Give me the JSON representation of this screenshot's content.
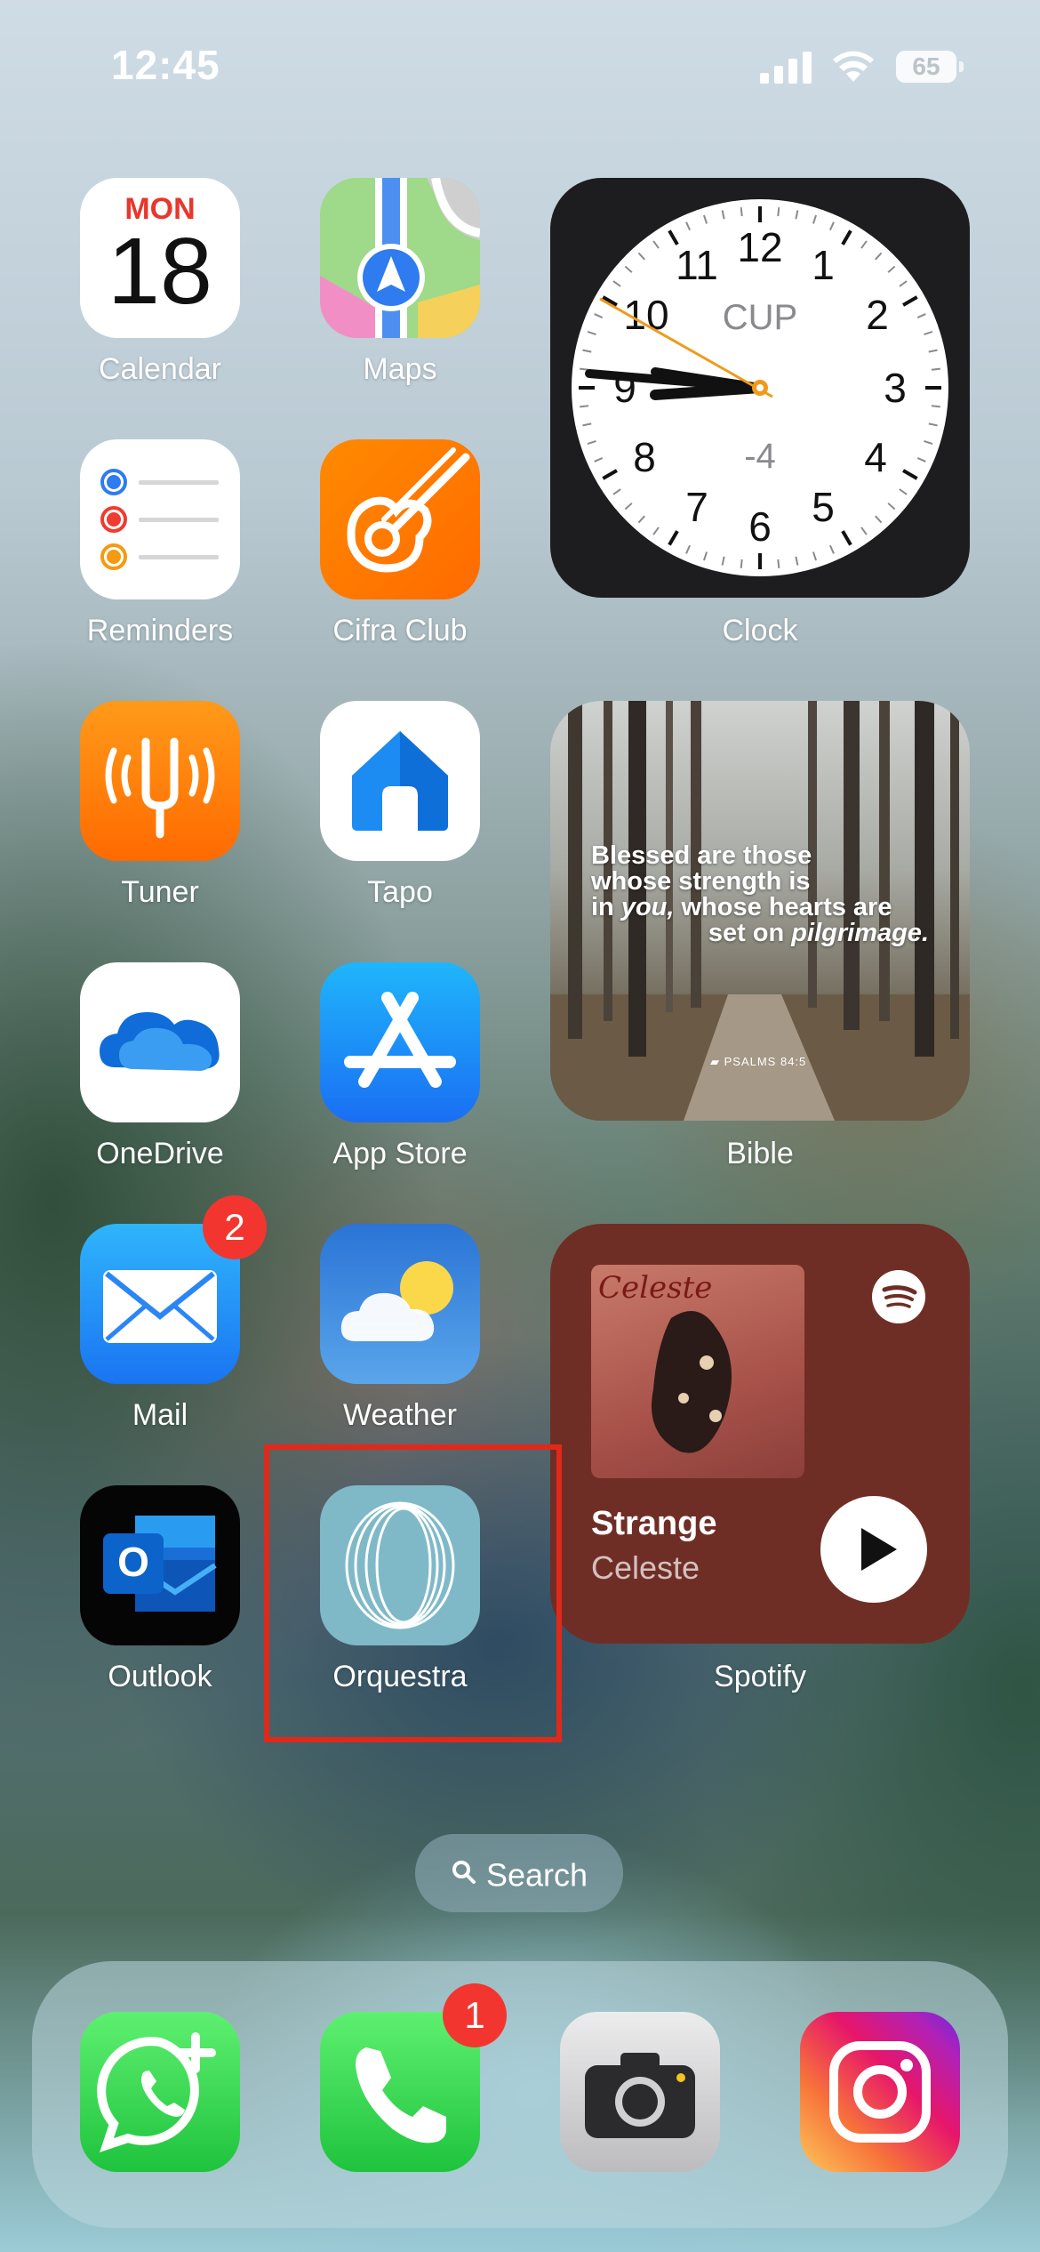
{
  "status_bar": {
    "time": "12:45",
    "battery": "65"
  },
  "apps": {
    "calendar": {
      "label": "Calendar",
      "day": "MON",
      "date": "18"
    },
    "maps": {
      "label": "Maps"
    },
    "reminders": {
      "label": "Reminders"
    },
    "cifra_club": {
      "label": "Cifra Club"
    },
    "tuner": {
      "label": "Tuner"
    },
    "tapo": {
      "label": "Tapo"
    },
    "onedrive": {
      "label": "OneDrive"
    },
    "app_store": {
      "label": "App Store"
    },
    "mail": {
      "label": "Mail",
      "badge": "2"
    },
    "weather": {
      "label": "Weather"
    },
    "outlook": {
      "label": "Outlook"
    },
    "orquestra": {
      "label": "Orquestra"
    }
  },
  "widgets": {
    "clock": {
      "label": "Clock",
      "city": "CUP",
      "offset": "-4",
      "numbers": [
        "12",
        "1",
        "2",
        "3",
        "4",
        "5",
        "6",
        "7",
        "8",
        "9",
        "10",
        "11"
      ]
    },
    "bible": {
      "label": "Bible",
      "verse_line1": "Blessed are those",
      "verse_line2": "whose strength is",
      "verse_line3_a": "in ",
      "verse_line3_b": "you,",
      "verse_line3_c": " whose hearts are",
      "verse_line4_a": "set on ",
      "verse_line4_b": "pilgrimage.",
      "reference": "PSALMS 84:5"
    },
    "spotify": {
      "label": "Spotify",
      "track": "Strange",
      "artist": "Celeste",
      "album_text": "Celeste"
    }
  },
  "search": {
    "label": "Search"
  },
  "dock": {
    "phone_badge": "1"
  },
  "colors": {
    "badge": "#f2362f",
    "highlight": "#e0291a",
    "spotify_bg": "#6f2e25"
  }
}
